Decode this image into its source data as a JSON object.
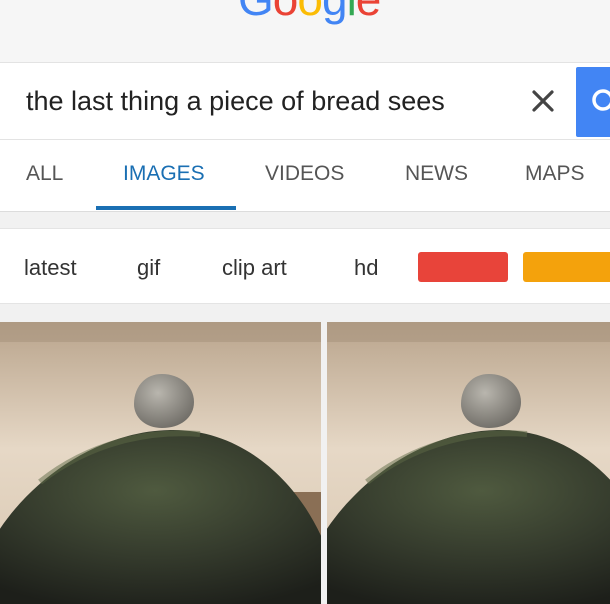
{
  "logo": {
    "letters": [
      "G",
      "o",
      "o",
      "g",
      "l",
      "e"
    ],
    "colors": [
      "#4285f4",
      "#ea4335",
      "#fbbc05",
      "#4285f4",
      "#34a853",
      "#ea4335"
    ]
  },
  "search": {
    "query": "the last thing a piece of bread sees",
    "clear_icon": "close-icon",
    "submit_icon": "search-icon",
    "accent": "#4285f4"
  },
  "tabs": [
    {
      "label": "ALL",
      "active": false
    },
    {
      "label": "IMAGES",
      "active": true
    },
    {
      "label": "VIDEOS",
      "active": false
    },
    {
      "label": "NEWS",
      "active": false
    },
    {
      "label": "MAPS",
      "active": false
    }
  ],
  "chips": {
    "labels": [
      "latest",
      "gif",
      "clip art",
      "hd"
    ],
    "color_filters": [
      "#e8443a",
      "#f4a20c"
    ]
  },
  "results": {
    "count": 2
  }
}
